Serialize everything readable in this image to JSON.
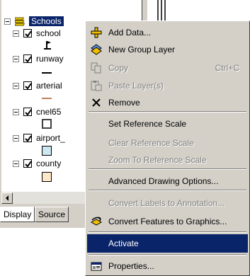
{
  "toc": {
    "group": {
      "label": "Schools"
    },
    "layers": [
      {
        "label": "school",
        "checked": true
      },
      {
        "label": "runway",
        "checked": true
      },
      {
        "label": "arterial",
        "checked": true
      },
      {
        "label": "cnel65",
        "checked": true
      },
      {
        "label": "airport_",
        "checked": true
      },
      {
        "label": "county",
        "checked": true
      }
    ],
    "tabs": {
      "display": "Display",
      "source": "Source"
    },
    "colors": {
      "runway_line": "#000000",
      "arterial_line": "#c08060",
      "airport_fill": "#cde6f0",
      "county_fill": "#fde8c8"
    }
  },
  "context_menu": {
    "items": [
      {
        "label": "Add Data...",
        "icon": "add-data-icon",
        "enabled": true
      },
      {
        "label": "New Group Layer",
        "icon": "new-group-layer-icon",
        "enabled": true
      },
      {
        "label": "Copy",
        "shortcut": "Ctrl+C",
        "icon": "copy-icon",
        "enabled": false
      },
      {
        "label": "Paste Layer(s)",
        "icon": "paste-icon",
        "enabled": false
      },
      {
        "label": "Remove",
        "icon": "remove-icon",
        "enabled": true
      },
      {
        "label": "Set Reference Scale",
        "enabled": true
      },
      {
        "label": "Clear Reference Scale",
        "enabled": false
      },
      {
        "label": "Zoom To Reference Scale",
        "enabled": false
      },
      {
        "label": "Advanced Drawing Options...",
        "enabled": true
      },
      {
        "label": "Convert Labels to Annotation...",
        "enabled": false
      },
      {
        "label": "Convert Features to Graphics...",
        "icon": "convert-graphics-icon",
        "enabled": true
      },
      {
        "label": "Activate",
        "enabled": true,
        "highlighted": true
      },
      {
        "label": "Properties...",
        "icon": "properties-icon",
        "enabled": true
      }
    ],
    "highlight_color": "#0a246a"
  }
}
